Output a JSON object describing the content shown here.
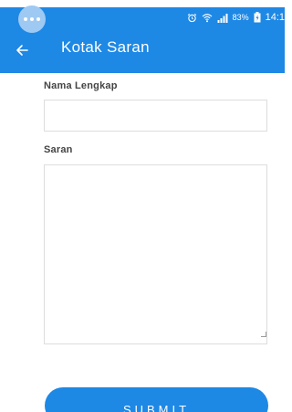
{
  "status_bar": {
    "battery_percent": "83%",
    "time": "14:1",
    "icons": [
      "alarm-icon",
      "wifi-icon",
      "signal-icon",
      "battery-icon"
    ]
  },
  "app_bar": {
    "title": "Kotak Saran",
    "back_icon": "arrow-left-icon"
  },
  "form": {
    "name_label": "Nama Lengkap",
    "name_value": "",
    "saran_label": "Saran",
    "saran_value": ""
  },
  "submit": {
    "label": "SUBMIT"
  },
  "colors": {
    "primary": "#1e88e5",
    "bubble": "#9ec9f3",
    "input_border": "#dddddd",
    "label_text": "#444444"
  }
}
